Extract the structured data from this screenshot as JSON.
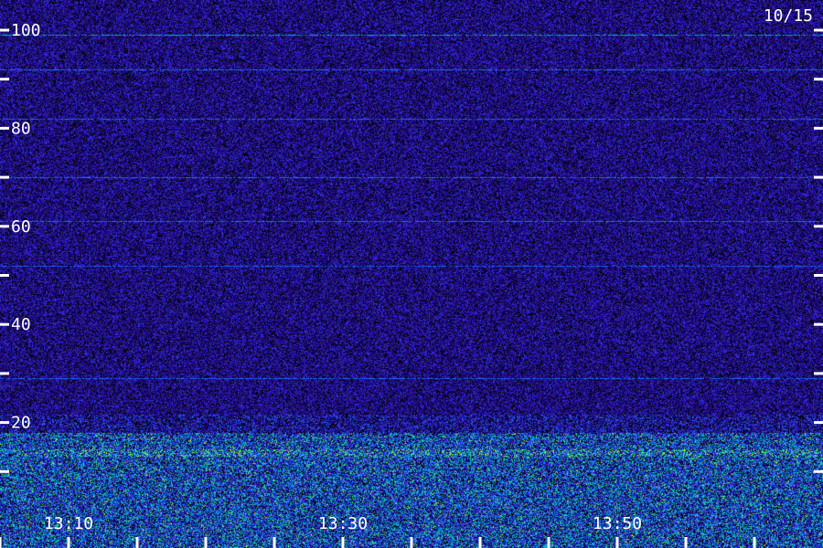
{
  "date_label": "10/15",
  "chart_data": {
    "type": "heatmap",
    "title": "",
    "xlabel": "",
    "ylabel": "",
    "y_unit": "",
    "y_range": [
      0,
      100
    ],
    "y_major_ticks": [
      20,
      40,
      60,
      80,
      100
    ],
    "y_minor_ticks": [
      10,
      30,
      50,
      70,
      90
    ],
    "x_range": [
      "13:05",
      "14:05"
    ],
    "x_tick_labels": [
      "13:10",
      "13:30",
      "13:50"
    ],
    "x_tick_labeled_times": [
      "13:10",
      "13:30",
      "13:50"
    ],
    "x_minor_tick_times": [
      "13:05",
      "13:10",
      "13:15",
      "13:20",
      "13:25",
      "13:30",
      "13:35",
      "13:40",
      "13:45",
      "13:50",
      "13:55",
      "14:00"
    ],
    "background_band": {
      "y_from": 0,
      "y_to": 100,
      "intensity": "low"
    },
    "high_intensity_band": {
      "y_from": 0,
      "y_to": 18
    },
    "horizontal_lines": [
      {
        "y": 99,
        "intensity": 0.6
      },
      {
        "y": 92,
        "intensity": 0.35
      },
      {
        "y": 82,
        "intensity": 0.3
      },
      {
        "y": 70,
        "intensity": 0.35
      },
      {
        "y": 61,
        "intensity": 0.3
      },
      {
        "y": 52,
        "intensity": 0.28
      },
      {
        "y": 29,
        "intensity": 0.3
      }
    ],
    "colormap": [
      "#000000",
      "#1a0a6e",
      "#3a14d2",
      "#1f5fff",
      "#00b0d0",
      "#27e07a",
      "#b8ff2a"
    ]
  }
}
